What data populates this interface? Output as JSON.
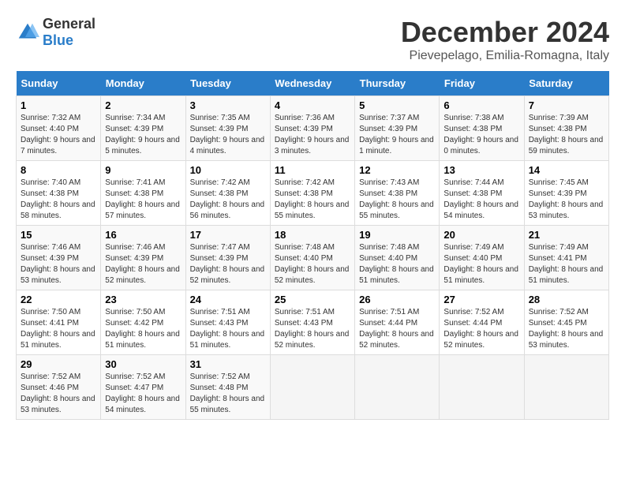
{
  "logo": {
    "text_general": "General",
    "text_blue": "Blue"
  },
  "header": {
    "month": "December 2024",
    "location": "Pievepelago, Emilia-Romagna, Italy"
  },
  "days_of_week": [
    "Sunday",
    "Monday",
    "Tuesday",
    "Wednesday",
    "Thursday",
    "Friday",
    "Saturday"
  ],
  "weeks": [
    [
      {
        "day": "1",
        "sunrise": "7:32 AM",
        "sunset": "4:40 PM",
        "daylight": "9 hours and 7 minutes."
      },
      {
        "day": "2",
        "sunrise": "7:34 AM",
        "sunset": "4:39 PM",
        "daylight": "9 hours and 5 minutes."
      },
      {
        "day": "3",
        "sunrise": "7:35 AM",
        "sunset": "4:39 PM",
        "daylight": "9 hours and 4 minutes."
      },
      {
        "day": "4",
        "sunrise": "7:36 AM",
        "sunset": "4:39 PM",
        "daylight": "9 hours and 3 minutes."
      },
      {
        "day": "5",
        "sunrise": "7:37 AM",
        "sunset": "4:39 PM",
        "daylight": "9 hours and 1 minute."
      },
      {
        "day": "6",
        "sunrise": "7:38 AM",
        "sunset": "4:38 PM",
        "daylight": "9 hours and 0 minutes."
      },
      {
        "day": "7",
        "sunrise": "7:39 AM",
        "sunset": "4:38 PM",
        "daylight": "8 hours and 59 minutes."
      }
    ],
    [
      {
        "day": "8",
        "sunrise": "7:40 AM",
        "sunset": "4:38 PM",
        "daylight": "8 hours and 58 minutes."
      },
      {
        "day": "9",
        "sunrise": "7:41 AM",
        "sunset": "4:38 PM",
        "daylight": "8 hours and 57 minutes."
      },
      {
        "day": "10",
        "sunrise": "7:42 AM",
        "sunset": "4:38 PM",
        "daylight": "8 hours and 56 minutes."
      },
      {
        "day": "11",
        "sunrise": "7:42 AM",
        "sunset": "4:38 PM",
        "daylight": "8 hours and 55 minutes."
      },
      {
        "day": "12",
        "sunrise": "7:43 AM",
        "sunset": "4:38 PM",
        "daylight": "8 hours and 55 minutes."
      },
      {
        "day": "13",
        "sunrise": "7:44 AM",
        "sunset": "4:38 PM",
        "daylight": "8 hours and 54 minutes."
      },
      {
        "day": "14",
        "sunrise": "7:45 AM",
        "sunset": "4:39 PM",
        "daylight": "8 hours and 53 minutes."
      }
    ],
    [
      {
        "day": "15",
        "sunrise": "7:46 AM",
        "sunset": "4:39 PM",
        "daylight": "8 hours and 53 minutes."
      },
      {
        "day": "16",
        "sunrise": "7:46 AM",
        "sunset": "4:39 PM",
        "daylight": "8 hours and 52 minutes."
      },
      {
        "day": "17",
        "sunrise": "7:47 AM",
        "sunset": "4:39 PM",
        "daylight": "8 hours and 52 minutes."
      },
      {
        "day": "18",
        "sunrise": "7:48 AM",
        "sunset": "4:40 PM",
        "daylight": "8 hours and 52 minutes."
      },
      {
        "day": "19",
        "sunrise": "7:48 AM",
        "sunset": "4:40 PM",
        "daylight": "8 hours and 51 minutes."
      },
      {
        "day": "20",
        "sunrise": "7:49 AM",
        "sunset": "4:40 PM",
        "daylight": "8 hours and 51 minutes."
      },
      {
        "day": "21",
        "sunrise": "7:49 AM",
        "sunset": "4:41 PM",
        "daylight": "8 hours and 51 minutes."
      }
    ],
    [
      {
        "day": "22",
        "sunrise": "7:50 AM",
        "sunset": "4:41 PM",
        "daylight": "8 hours and 51 minutes."
      },
      {
        "day": "23",
        "sunrise": "7:50 AM",
        "sunset": "4:42 PM",
        "daylight": "8 hours and 51 minutes."
      },
      {
        "day": "24",
        "sunrise": "7:51 AM",
        "sunset": "4:43 PM",
        "daylight": "8 hours and 51 minutes."
      },
      {
        "day": "25",
        "sunrise": "7:51 AM",
        "sunset": "4:43 PM",
        "daylight": "8 hours and 52 minutes."
      },
      {
        "day": "26",
        "sunrise": "7:51 AM",
        "sunset": "4:44 PM",
        "daylight": "8 hours and 52 minutes."
      },
      {
        "day": "27",
        "sunrise": "7:52 AM",
        "sunset": "4:44 PM",
        "daylight": "8 hours and 52 minutes."
      },
      {
        "day": "28",
        "sunrise": "7:52 AM",
        "sunset": "4:45 PM",
        "daylight": "8 hours and 53 minutes."
      }
    ],
    [
      {
        "day": "29",
        "sunrise": "7:52 AM",
        "sunset": "4:46 PM",
        "daylight": "8 hours and 53 minutes."
      },
      {
        "day": "30",
        "sunrise": "7:52 AM",
        "sunset": "4:47 PM",
        "daylight": "8 hours and 54 minutes."
      },
      {
        "day": "31",
        "sunrise": "7:52 AM",
        "sunset": "4:48 PM",
        "daylight": "8 hours and 55 minutes."
      },
      null,
      null,
      null,
      null
    ]
  ],
  "labels": {
    "sunrise": "Sunrise:",
    "sunset": "Sunset:",
    "daylight": "Daylight:"
  }
}
